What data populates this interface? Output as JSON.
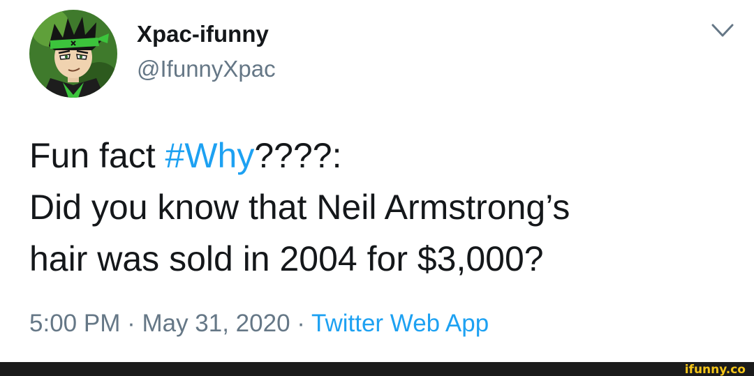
{
  "tweet": {
    "display_name": "Xpac-ifunny",
    "handle": "@IfunnyXpac",
    "text_line1_prefix": "Fun fact ",
    "hashtag": "#Why",
    "text_line1_suffix": "????:",
    "text_line2": "Did you know that Neil Armstrong’s",
    "text_line3": "hair was sold in 2004 for $3,000?",
    "timestamp": "5:00 PM · May 31, 2020 · ",
    "source": "Twitter Web App"
  },
  "icons": {
    "more": "chevron-down-icon",
    "avatar": "avatar"
  },
  "watermark": {
    "text": "ifunny.co"
  },
  "colors": {
    "link": "#1da1f2",
    "secondary_text": "#657786",
    "primary_text": "#14171a",
    "watermark_text": "#f5c518",
    "footer_bar": "#1b1b1b"
  }
}
